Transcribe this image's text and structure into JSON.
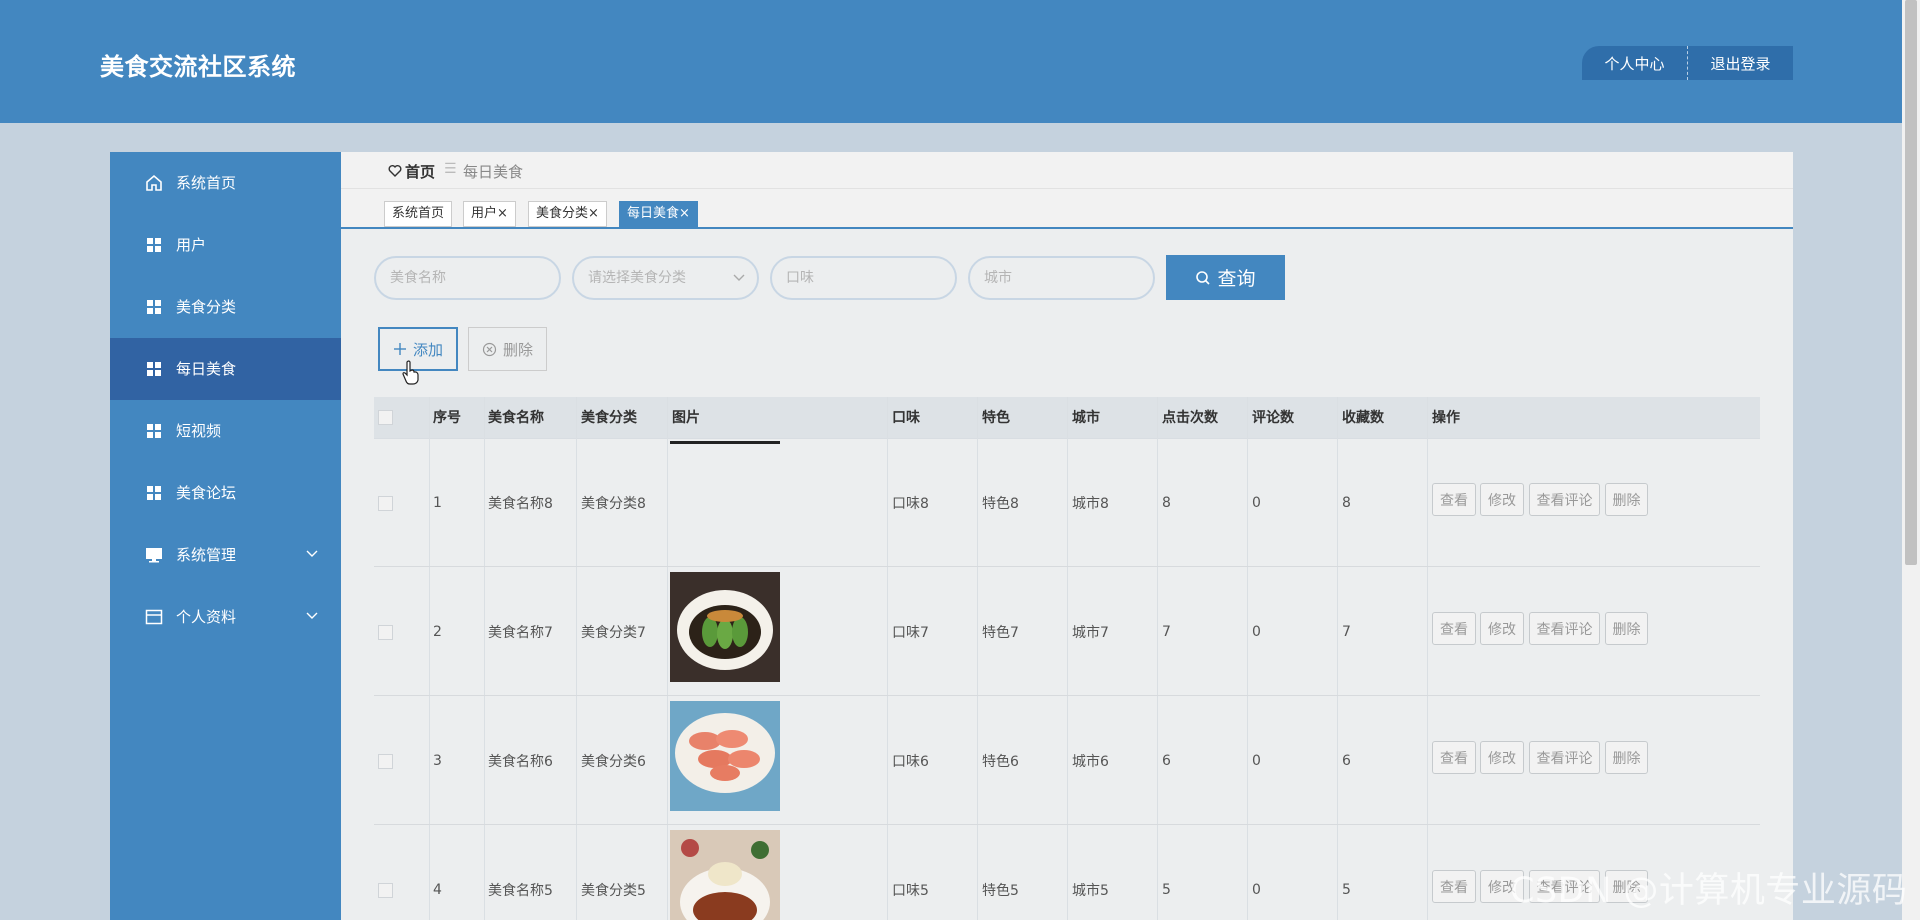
{
  "app": {
    "title": "美食交流社区系统"
  },
  "header_menu": {
    "profile": "个人中心",
    "logout": "退出登录"
  },
  "sidebar": {
    "items": [
      {
        "label": "系统首页",
        "icon": "home-icon"
      },
      {
        "label": "用户",
        "icon": "grid-icon"
      },
      {
        "label": "美食分类",
        "icon": "grid-icon"
      },
      {
        "label": "每日美食",
        "icon": "grid-icon",
        "active": true
      },
      {
        "label": "短视频",
        "icon": "grid-icon"
      },
      {
        "label": "美食论坛",
        "icon": "grid-icon"
      },
      {
        "label": "系统管理",
        "icon": "monitor-icon",
        "expandable": true
      },
      {
        "label": "个人资料",
        "icon": "card-icon",
        "expandable": true
      }
    ]
  },
  "breadcrumb": {
    "home": "首页",
    "current": "每日美食"
  },
  "tabs": [
    {
      "label": "系统首页"
    },
    {
      "label": "用户×"
    },
    {
      "label": "美食分类×"
    },
    {
      "label": "每日美食×",
      "active": true
    }
  ],
  "search": {
    "name_placeholder": "美食名称",
    "category_placeholder": "请选择美食分类",
    "taste_placeholder": "口味",
    "city_placeholder": "城市",
    "query_label": "查询"
  },
  "actions": {
    "add": "添加",
    "delete": "删除"
  },
  "table": {
    "columns": [
      "序号",
      "美食名称",
      "美食分类",
      "图片",
      "口味",
      "特色",
      "城市",
      "点击次数",
      "评论数",
      "收藏数",
      "操作"
    ],
    "row_buttons": [
      "查看",
      "修改",
      "查看评论",
      "删除"
    ],
    "rows": [
      {
        "index": "1",
        "name": "美食名称8",
        "category": "美食分类8",
        "taste": "口味8",
        "feature": "特色8",
        "city": "城市8",
        "clicks": "8",
        "comments": "0",
        "favorites": "8",
        "image": ""
      },
      {
        "index": "2",
        "name": "美食名称7",
        "category": "美食分类7",
        "taste": "口味7",
        "feature": "特色7",
        "city": "城市7",
        "clicks": "7",
        "comments": "0",
        "favorites": "7",
        "image": "cucumber-dish-photo"
      },
      {
        "index": "3",
        "name": "美食名称6",
        "category": "美食分类6",
        "taste": "口味6",
        "feature": "特色6",
        "city": "城市6",
        "clicks": "6",
        "comments": "0",
        "favorites": "6",
        "image": "shrimp-dish-photo"
      },
      {
        "index": "4",
        "name": "美食名称5",
        "category": "美食分类5",
        "taste": "口味5",
        "feature": "特色5",
        "city": "城市5",
        "clicks": "5",
        "comments": "0",
        "favorites": "5",
        "image": "rice-dish-photo"
      }
    ]
  },
  "watermark": "CSDN @计算机专业源码"
}
